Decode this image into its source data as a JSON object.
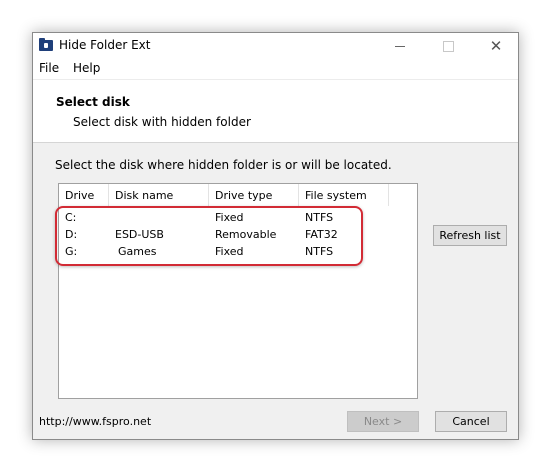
{
  "window": {
    "title": "Hide Folder Ext",
    "close_glyph": "✕"
  },
  "menu": {
    "file": "File",
    "help": "Help"
  },
  "header": {
    "title": "Select disk",
    "subtitle": "Select disk with hidden folder"
  },
  "instruction": "Select the disk where hidden folder is or will be located.",
  "disk_list": {
    "columns": [
      "Drive",
      "Disk name",
      "Drive type",
      "File system"
    ],
    "rows": [
      {
        "drive": "C:",
        "name": "",
        "type": "Fixed",
        "fs": "NTFS"
      },
      {
        "drive": "D:",
        "name": "ESD-USB",
        "type": "Removable",
        "fs": "FAT32"
      },
      {
        "drive": "G:",
        "name": "Games",
        "type": "Fixed",
        "fs": "NTFS"
      }
    ]
  },
  "buttons": {
    "refresh": "Refresh list",
    "next": "Next >",
    "cancel": "Cancel"
  },
  "footer": {
    "url": "http://www.fspro.net"
  },
  "colors": {
    "highlight": "#d22b35"
  }
}
